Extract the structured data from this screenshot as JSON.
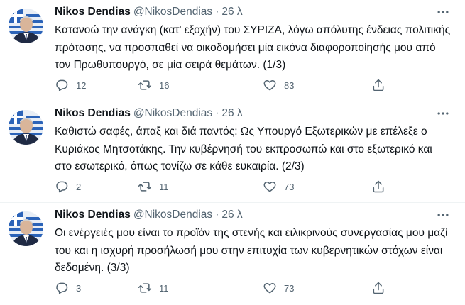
{
  "colors": {
    "text": "#0f1419",
    "secondary": "#536471",
    "divider": "#eff3f4"
  },
  "icons": {
    "reply": "reply-icon",
    "retweet": "retweet-icon",
    "like": "heart-icon",
    "share": "share-icon",
    "more": "more-icon"
  },
  "tweets": [
    {
      "name": "Nikos Dendias",
      "handle": "@NikosDendias",
      "dot": "·",
      "time": "26 λ",
      "text": "Κατανοώ την ανάγκη (κατ' εξοχήν) του ΣΥΡΙΖΑ, λόγω απόλυτης ένδειας πολιτικής πρότασης, να προσπαθεί να οικοδομήσει μία εικόνα διαφοροποίησής μου από τον Πρωθυπουργό, σε μία σειρά θεμάτων. (1/3)",
      "replies": "12",
      "retweets": "16",
      "likes": "83"
    },
    {
      "name": "Nikos Dendias",
      "handle": "@NikosDendias",
      "dot": "·",
      "time": "26 λ",
      "text": "Καθιστώ σαφές, άπαξ και διά παντός: Ως Υπουργό Εξωτερικών με επέλεξε ο Κυριάκος Μητσοτάκης. Την κυβέρνησή του εκπροσωπώ και στο εξωτερικό και στο εσωτερικό, όπως τονίζω σε κάθε ευκαιρία. (2/3)",
      "replies": "2",
      "retweets": "11",
      "likes": "73"
    },
    {
      "name": "Nikos Dendias",
      "handle": "@NikosDendias",
      "dot": "·",
      "time": "26 λ",
      "text": "Οι ενέργειές μου είναι το προϊόν της στενής και ειλικρινούς συνεργασίας μου μαζί του και η ισχυρή προσήλωσή μου στην επιτυχία των κυβερνητικών στόχων είναι δεδομένη. (3/3)",
      "replies": "3",
      "retweets": "11",
      "likes": "73"
    }
  ]
}
